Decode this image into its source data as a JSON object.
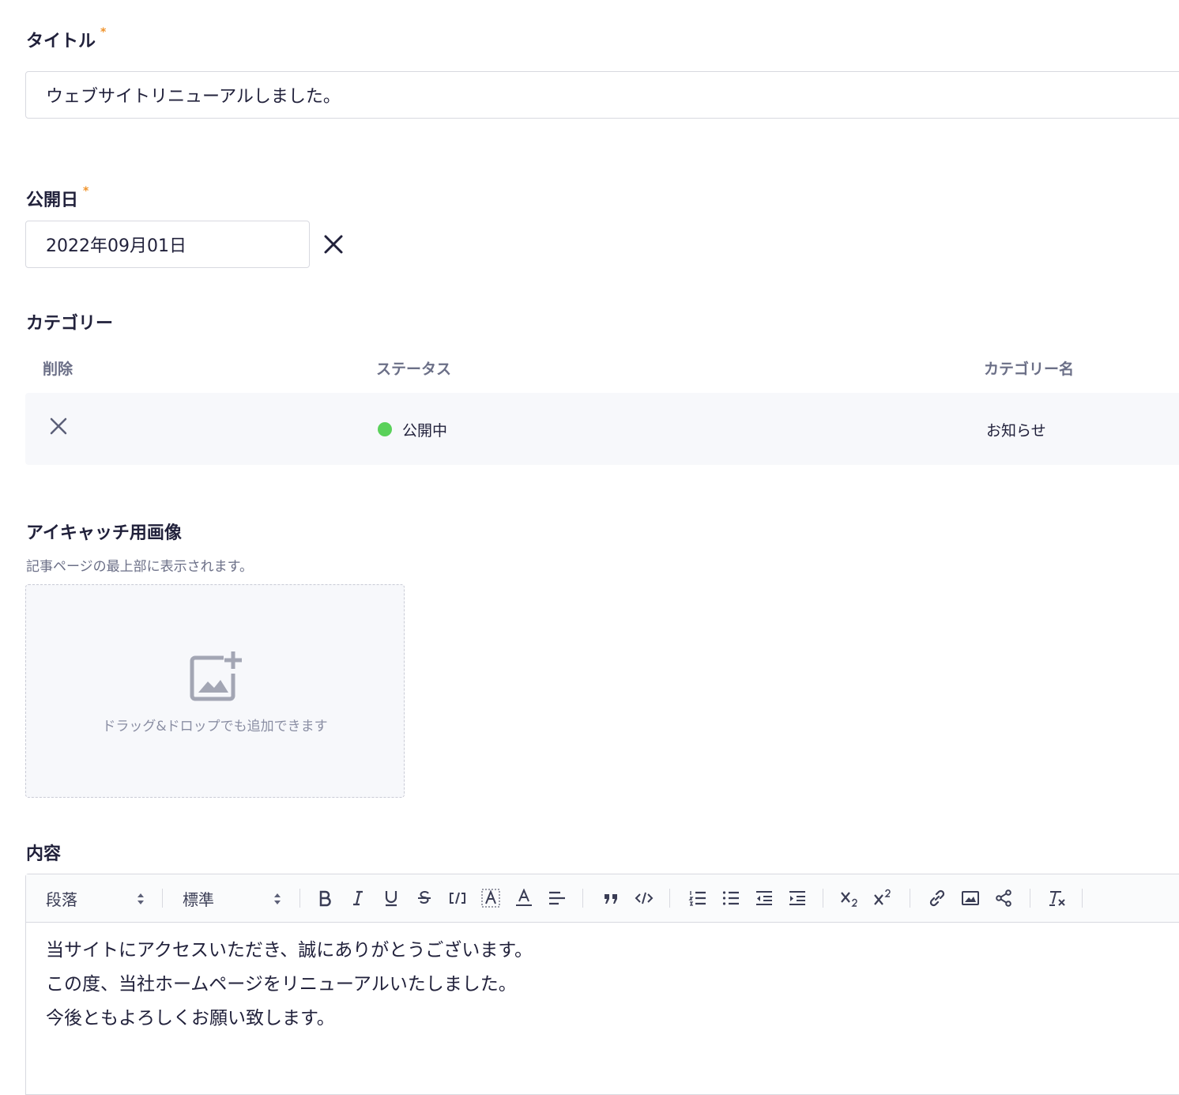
{
  "title_field": {
    "label": "タイトル",
    "required_mark": "*",
    "value": "ウェブサイトリニューアルしました。"
  },
  "publish_date": {
    "label": "公開日",
    "required_mark": "*",
    "value": "2022年09月01日",
    "clear_icon": "close-icon"
  },
  "category": {
    "label": "カテゴリー",
    "columns": [
      "削除",
      "ステータス",
      "カテゴリー名"
    ],
    "rows": [
      {
        "status": "公開中",
        "status_color": "#5ad15a",
        "name": "お知らせ"
      }
    ]
  },
  "eyecatch": {
    "label": "アイキャッチ用画像",
    "description": "記事ページの最上部に表示されます。",
    "dropzone_text": "ドラッグ&ドロップでも追加できます"
  },
  "content": {
    "label": "内容",
    "toolbar": {
      "block_format": "段落",
      "font_size": "標準",
      "buttons": [
        "bold",
        "italic",
        "underline",
        "strikethrough",
        "inline-code",
        "highlight",
        "text-color",
        "align",
        "blockquote",
        "code-block",
        "ordered-list",
        "bullet-list",
        "outdent",
        "indent",
        "subscript",
        "superscript",
        "link",
        "image",
        "embed",
        "clear-format"
      ]
    },
    "lines": [
      "当サイトにアクセスいただき、誠にありがとうございます。",
      "この度、当社ホームページをリニューアルいたしました。",
      "今後ともよろしくお願い致します。"
    ]
  },
  "colors": {
    "required": "#f0932b",
    "status_published": "#5ad15a",
    "text": "#21213b",
    "muted": "#6b6f87"
  }
}
